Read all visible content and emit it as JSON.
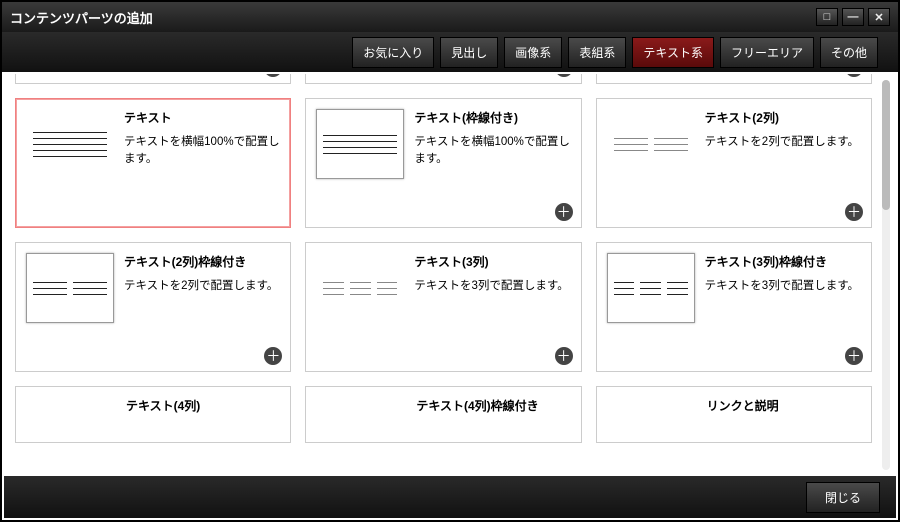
{
  "title": "コンテンツパーツの追加",
  "tabs": [
    {
      "label": "お気に入り",
      "active": false
    },
    {
      "label": "見出し",
      "active": false
    },
    {
      "label": "画像系",
      "active": false
    },
    {
      "label": "表組系",
      "active": false
    },
    {
      "label": "テキスト系",
      "active": true
    },
    {
      "label": "フリーエリア",
      "active": false
    },
    {
      "label": "その他",
      "active": false
    }
  ],
  "cards": [
    {
      "title": "テキスト",
      "desc": "テキストを横幅100%で配置します。",
      "selected": true,
      "add": false,
      "thumb": "lines-full"
    },
    {
      "title": "テキスト(枠線付き)",
      "desc": "テキストを横幅100%で配置します。",
      "selected": false,
      "add": true,
      "thumb": "lines-box"
    },
    {
      "title": "テキスト(2列)",
      "desc": "テキストを2列で配置します。",
      "selected": false,
      "add": true,
      "thumb": "cols2-light"
    },
    {
      "title": "テキスト(2列)枠線付き",
      "desc": "テキストを2列で配置します。",
      "selected": false,
      "add": true,
      "thumb": "cols2"
    },
    {
      "title": "テキスト(3列)",
      "desc": "テキストを3列で配置します。",
      "selected": false,
      "add": true,
      "thumb": "cols3-light"
    },
    {
      "title": "テキスト(3列)枠線付き",
      "desc": "テキストを3列で配置します。",
      "selected": false,
      "add": true,
      "thumb": "cols3"
    },
    {
      "title": "テキスト(4列)",
      "desc": "",
      "selected": false,
      "add": true,
      "thumb": "none"
    },
    {
      "title": "テキスト(4列)枠線付き",
      "desc": "",
      "selected": false,
      "add": true,
      "thumb": "none"
    },
    {
      "title": "リンクと説明",
      "desc": "",
      "selected": false,
      "add": true,
      "thumb": "none"
    }
  ],
  "close_label": "閉じる",
  "icons": {
    "plus": "＋",
    "check": "✓",
    "maximize": "□",
    "minimize": "—",
    "close": "✕"
  }
}
